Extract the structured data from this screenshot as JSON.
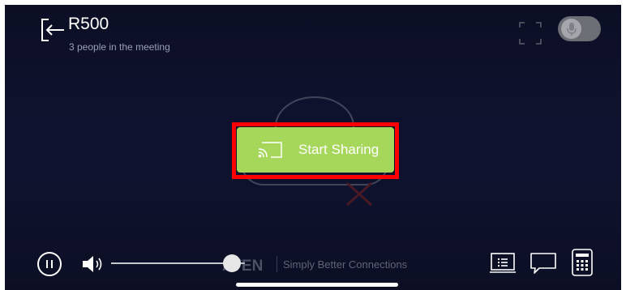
{
  "header": {
    "title": "R500",
    "subtitle": "3 people in the meeting",
    "back_icon": "exit-arrow-icon",
    "expand_icon": "fullscreen-corners-icon",
    "mic_icon": "microphone-icon",
    "mic_enabled": false
  },
  "main": {
    "share_label": "Start Sharing",
    "share_icon": "cast-icon",
    "button_color": "#a6d65a",
    "highlight_color": "#ff0000"
  },
  "footer": {
    "pause_icon": "pause-icon",
    "volume_icon": "speaker-icon",
    "volume_level": 0.9,
    "brand": "ATEN",
    "tagline": "Simply Better Connections",
    "list_icon": "list-icon",
    "chat_icon": "chat-bubble-icon",
    "keypad_icon": "keypad-icon"
  }
}
